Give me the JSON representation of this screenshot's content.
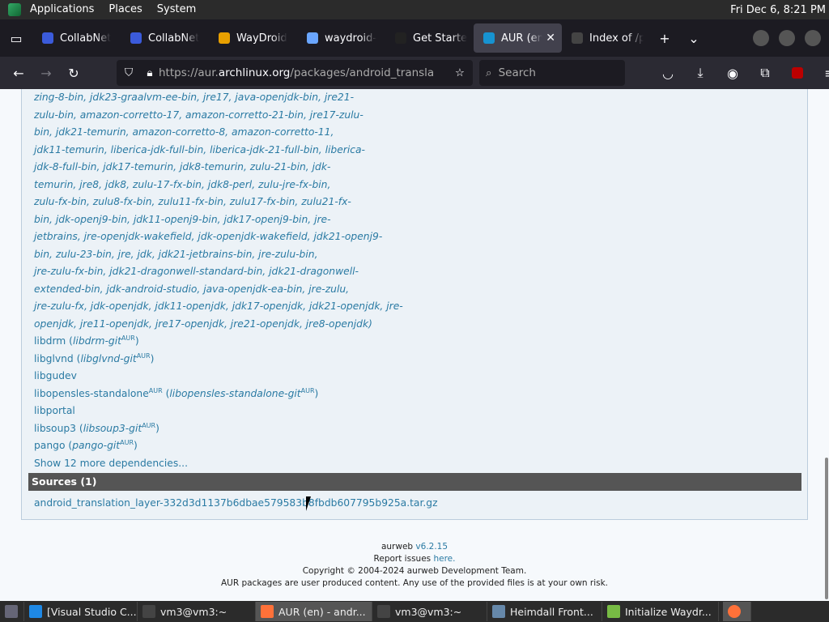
{
  "topbar": {
    "menus": [
      "Applications",
      "Places",
      "System"
    ],
    "clock": "Fri Dec 6,  8:21 PM"
  },
  "tabs": [
    {
      "title": "CollabNet",
      "color": "#3b5bdb"
    },
    {
      "title": "CollabNet",
      "color": "#3b5bdb"
    },
    {
      "title": "WayDroid",
      "color": "#e8a000"
    },
    {
      "title": "waydroid-",
      "color": "#6aa6ff"
    },
    {
      "title": "Get Starte",
      "color": "#222"
    },
    {
      "title": "AUR (en)",
      "color": "#1793d1",
      "active": true
    },
    {
      "title": "Index of /pfp_",
      "color": "#444"
    }
  ],
  "nav": {
    "url_prefix": "https://aur.",
    "url_domain": "archlinux.org",
    "url_suffix": "/packages/android_translation",
    "search_placeholder": "Search"
  },
  "deps_html": [
    "zing-8-bin, jdk23-graalvm-ee-bin, jre17, java-openjdk-bin, jre21-",
    "zulu-bin, amazon-corretto-17, amazon-corretto-21-bin, jre17-zulu-",
    "bin, jdk21-temurin, amazon-corretto-8, amazon-corretto-11,",
    "jdk11-temurin, liberica-jdk-full-bin, liberica-jdk-21-full-bin, liberica-",
    "jdk-8-full-bin, jdk17-temurin, jdk8-temurin, zulu-21-bin, jdk-",
    "temurin, jre8, jdk8, zulu-17-fx-bin, jdk8-perl, zulu-jre-fx-bin,",
    "zulu-fx-bin, zulu8-fx-bin, zulu11-fx-bin, zulu17-fx-bin, zulu21-fx-",
    "bin, jdk-openj9-bin, jdk11-openj9-bin, jdk17-openj9-bin, jre-",
    "jetbrains, jre-openjdk-wakefield, jdk-openjdk-wakefield, jdk21-openj9-",
    "bin, zulu-23-bin, jre, jdk, jdk21-jetbrains-bin, jre-zulu-bin,",
    "jre-zulu-fx-bin, jdk21-dragonwell-standard-bin, jdk21-dragonwell-",
    "extended-bin, jdk-android-studio, java-openjdk-ea-bin, jre-zulu,",
    "jre-zulu-fx, jdk-openjdk, jdk11-openjdk, jdk17-openjdk, jdk21-openjdk, jre-",
    "openjdk, jre11-openjdk, jre17-openjdk, jre21-openjdk, jre8-openjdk)"
  ],
  "deps": [
    {
      "name": "libdrm",
      "alt": "libdrm-git"
    },
    {
      "name": "libglvnd",
      "alt": "libglvnd-git"
    },
    {
      "name": "libgudev",
      "alt": ""
    },
    {
      "name": "libopensles-standalone",
      "alt": "libopensles-standalone-git",
      "aur": true
    },
    {
      "name": "libportal",
      "alt": ""
    },
    {
      "name": "libsoup3",
      "alt": "libsoup3-git"
    },
    {
      "name": "pango",
      "alt": "pango-git"
    }
  ],
  "aur_mark": "AUR",
  "show_more": "Show 12 more dependencies...",
  "sources": {
    "heading": "Sources (1)",
    "file": "android_translation_layer-332d3d1137b6dbae579583b8fbdb607795b925a.tar.gz"
  },
  "footer": {
    "aurweb": "aurweb",
    "version": "v6.2.15",
    "report": "Report issues",
    "here": "here.",
    "copyright": "Copyright © 2004-2024 aurweb Development Team.",
    "disclaimer": "AUR packages are user produced content. Any use of the provided files is at your own risk."
  },
  "taskbar": [
    {
      "label": "[Visual Studio C...",
      "color": "#1e88e5"
    },
    {
      "label": "vm3@vm3:~",
      "color": "#444"
    },
    {
      "label": "AUR (en) - andr...",
      "color": "#ff7139",
      "active": true
    },
    {
      "label": "vm3@vm3:~",
      "color": "#444"
    },
    {
      "label": "Heimdall Front...",
      "color": "#6688aa"
    },
    {
      "label": "Initialize Waydr...",
      "color": "#77bb44"
    }
  ]
}
